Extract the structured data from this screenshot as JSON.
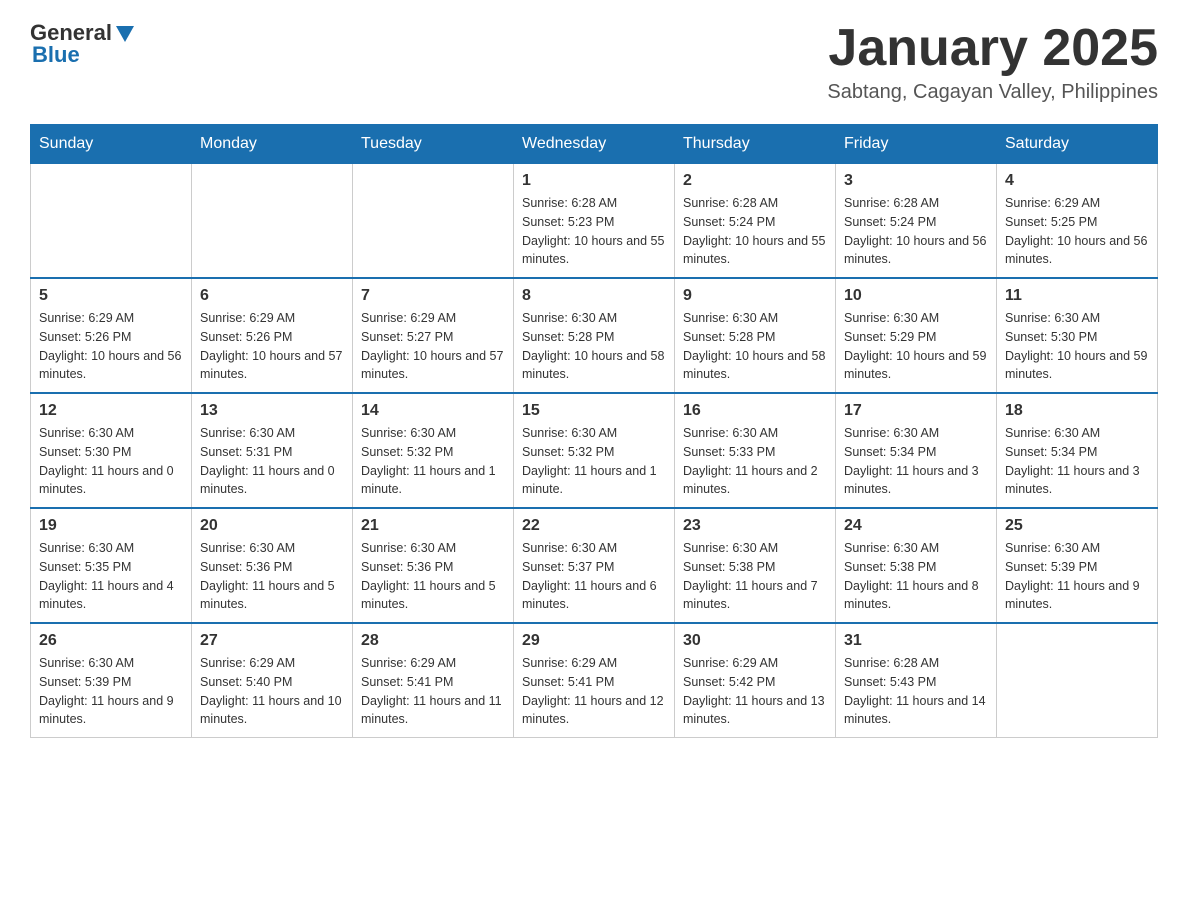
{
  "header": {
    "logo_general": "General",
    "logo_blue": "Blue",
    "title": "January 2025",
    "subtitle": "Sabtang, Cagayan Valley, Philippines"
  },
  "days_of_week": [
    "Sunday",
    "Monday",
    "Tuesday",
    "Wednesday",
    "Thursday",
    "Friday",
    "Saturday"
  ],
  "weeks": [
    [
      {
        "day": "",
        "info": ""
      },
      {
        "day": "",
        "info": ""
      },
      {
        "day": "",
        "info": ""
      },
      {
        "day": "1",
        "info": "Sunrise: 6:28 AM\nSunset: 5:23 PM\nDaylight: 10 hours and 55 minutes."
      },
      {
        "day": "2",
        "info": "Sunrise: 6:28 AM\nSunset: 5:24 PM\nDaylight: 10 hours and 55 minutes."
      },
      {
        "day": "3",
        "info": "Sunrise: 6:28 AM\nSunset: 5:24 PM\nDaylight: 10 hours and 56 minutes."
      },
      {
        "day": "4",
        "info": "Sunrise: 6:29 AM\nSunset: 5:25 PM\nDaylight: 10 hours and 56 minutes."
      }
    ],
    [
      {
        "day": "5",
        "info": "Sunrise: 6:29 AM\nSunset: 5:26 PM\nDaylight: 10 hours and 56 minutes."
      },
      {
        "day": "6",
        "info": "Sunrise: 6:29 AM\nSunset: 5:26 PM\nDaylight: 10 hours and 57 minutes."
      },
      {
        "day": "7",
        "info": "Sunrise: 6:29 AM\nSunset: 5:27 PM\nDaylight: 10 hours and 57 minutes."
      },
      {
        "day": "8",
        "info": "Sunrise: 6:30 AM\nSunset: 5:28 PM\nDaylight: 10 hours and 58 minutes."
      },
      {
        "day": "9",
        "info": "Sunrise: 6:30 AM\nSunset: 5:28 PM\nDaylight: 10 hours and 58 minutes."
      },
      {
        "day": "10",
        "info": "Sunrise: 6:30 AM\nSunset: 5:29 PM\nDaylight: 10 hours and 59 minutes."
      },
      {
        "day": "11",
        "info": "Sunrise: 6:30 AM\nSunset: 5:30 PM\nDaylight: 10 hours and 59 minutes."
      }
    ],
    [
      {
        "day": "12",
        "info": "Sunrise: 6:30 AM\nSunset: 5:30 PM\nDaylight: 11 hours and 0 minutes."
      },
      {
        "day": "13",
        "info": "Sunrise: 6:30 AM\nSunset: 5:31 PM\nDaylight: 11 hours and 0 minutes."
      },
      {
        "day": "14",
        "info": "Sunrise: 6:30 AM\nSunset: 5:32 PM\nDaylight: 11 hours and 1 minute."
      },
      {
        "day": "15",
        "info": "Sunrise: 6:30 AM\nSunset: 5:32 PM\nDaylight: 11 hours and 1 minute."
      },
      {
        "day": "16",
        "info": "Sunrise: 6:30 AM\nSunset: 5:33 PM\nDaylight: 11 hours and 2 minutes."
      },
      {
        "day": "17",
        "info": "Sunrise: 6:30 AM\nSunset: 5:34 PM\nDaylight: 11 hours and 3 minutes."
      },
      {
        "day": "18",
        "info": "Sunrise: 6:30 AM\nSunset: 5:34 PM\nDaylight: 11 hours and 3 minutes."
      }
    ],
    [
      {
        "day": "19",
        "info": "Sunrise: 6:30 AM\nSunset: 5:35 PM\nDaylight: 11 hours and 4 minutes."
      },
      {
        "day": "20",
        "info": "Sunrise: 6:30 AM\nSunset: 5:36 PM\nDaylight: 11 hours and 5 minutes."
      },
      {
        "day": "21",
        "info": "Sunrise: 6:30 AM\nSunset: 5:36 PM\nDaylight: 11 hours and 5 minutes."
      },
      {
        "day": "22",
        "info": "Sunrise: 6:30 AM\nSunset: 5:37 PM\nDaylight: 11 hours and 6 minutes."
      },
      {
        "day": "23",
        "info": "Sunrise: 6:30 AM\nSunset: 5:38 PM\nDaylight: 11 hours and 7 minutes."
      },
      {
        "day": "24",
        "info": "Sunrise: 6:30 AM\nSunset: 5:38 PM\nDaylight: 11 hours and 8 minutes."
      },
      {
        "day": "25",
        "info": "Sunrise: 6:30 AM\nSunset: 5:39 PM\nDaylight: 11 hours and 9 minutes."
      }
    ],
    [
      {
        "day": "26",
        "info": "Sunrise: 6:30 AM\nSunset: 5:39 PM\nDaylight: 11 hours and 9 minutes."
      },
      {
        "day": "27",
        "info": "Sunrise: 6:29 AM\nSunset: 5:40 PM\nDaylight: 11 hours and 10 minutes."
      },
      {
        "day": "28",
        "info": "Sunrise: 6:29 AM\nSunset: 5:41 PM\nDaylight: 11 hours and 11 minutes."
      },
      {
        "day": "29",
        "info": "Sunrise: 6:29 AM\nSunset: 5:41 PM\nDaylight: 11 hours and 12 minutes."
      },
      {
        "day": "30",
        "info": "Sunrise: 6:29 AM\nSunset: 5:42 PM\nDaylight: 11 hours and 13 minutes."
      },
      {
        "day": "31",
        "info": "Sunrise: 6:28 AM\nSunset: 5:43 PM\nDaylight: 11 hours and 14 minutes."
      },
      {
        "day": "",
        "info": ""
      }
    ]
  ]
}
